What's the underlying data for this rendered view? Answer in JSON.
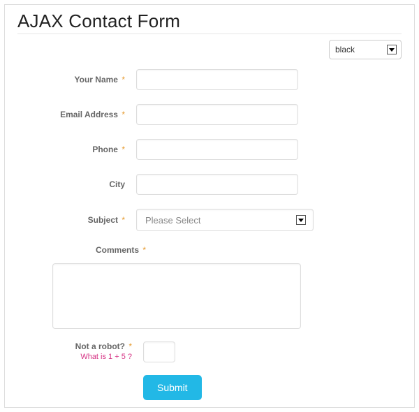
{
  "title": "AJAX Contact Form",
  "theme": {
    "selected": "black"
  },
  "required_mark": "*",
  "fields": {
    "name": {
      "label": "Your Name",
      "required": true,
      "value": ""
    },
    "email": {
      "label": "Email Address",
      "required": true,
      "value": ""
    },
    "phone": {
      "label": "Phone",
      "required": true,
      "value": ""
    },
    "city": {
      "label": "City",
      "required": false,
      "value": ""
    },
    "subject": {
      "label": "Subject",
      "required": true,
      "selected": "Please Select"
    },
    "comments": {
      "label": "Comments",
      "required": true,
      "value": ""
    },
    "robot": {
      "label": "Not a robot?",
      "required": true,
      "question": "What is 1 + 5 ?",
      "value": ""
    }
  },
  "submit_label": "Submit"
}
